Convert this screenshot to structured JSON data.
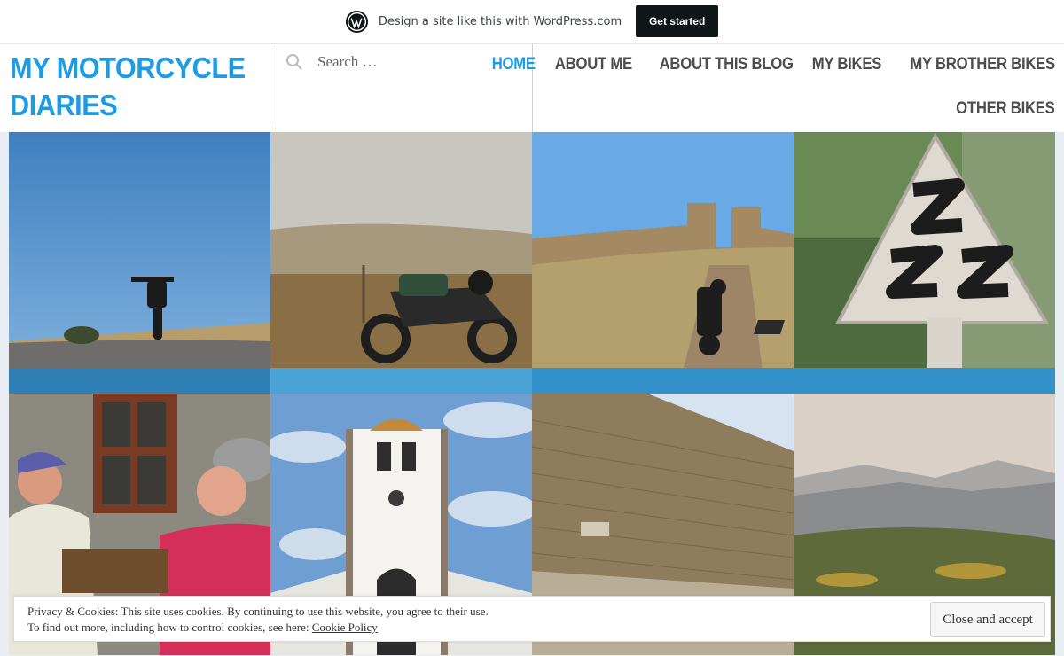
{
  "wp_banner": {
    "logo_icon": "wordpress-logo-icon",
    "text": "Design a site like this with WordPress.com",
    "cta_label": "Get started"
  },
  "header": {
    "site_title": "MY MOTORCYCLE DIARIES",
    "accent_color": "#1e9ce3"
  },
  "search": {
    "icon": "search-icon",
    "placeholder": "Search …"
  },
  "nav": {
    "items": [
      {
        "label": "HOME",
        "active": true
      },
      {
        "label": "ABOUT ME",
        "active": false
      },
      {
        "label": "ABOUT THIS BLOG",
        "active": false
      },
      {
        "label": "MY BIKES",
        "active": false
      },
      {
        "label": "MY BROTHER BIKES",
        "active": false
      },
      {
        "label": "OTHER BIKES",
        "active": false
      }
    ]
  },
  "gallery": {
    "tiles": [
      {
        "subject": "motorcycle on road under blue sky"
      },
      {
        "subject": "motorcycle in foggy field"
      },
      {
        "subject": "motorcycle on dirt path below castle"
      },
      {
        "subject": "zigzag road sign"
      },
      {
        "subject": "men playing cards"
      },
      {
        "subject": "white church bell tower"
      },
      {
        "subject": "ancient stone wall"
      },
      {
        "subject": "hazy mountain landscape"
      }
    ]
  },
  "cookie": {
    "line1": "Privacy & Cookies: This site uses cookies. By continuing to use this website, you agree to their use.",
    "line2_prefix": "To find out more, including how to control cookies, see here: ",
    "link_label": "Cookie Policy",
    "button_label": "Close and accept"
  }
}
